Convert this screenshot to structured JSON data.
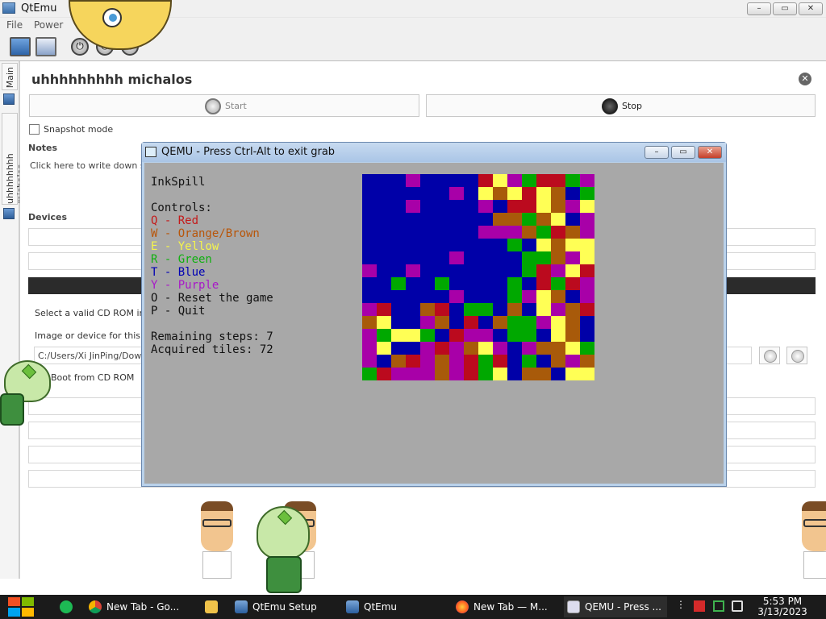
{
  "qtemu": {
    "title": "QtEmu",
    "menu": [
      "File",
      "Power"
    ],
    "window_buttons": [
      "–",
      "▭",
      "✕"
    ],
    "power_icons": [
      "⏻",
      "⏻",
      "⏻"
    ]
  },
  "side_tabs": [
    "Main",
    "uhhhhhhhh michalos"
  ],
  "machine": {
    "name": "uhhhhhhhhh michalos",
    "start_label": "Start",
    "stop_label": "Stop",
    "snapshot_label": "Snapshot mode",
    "notes_label": "Notes",
    "notes_placeholder": "Click here to write down some",
    "devices_label": "Devices",
    "cdrom_hint": "Select a valid CD ROM image",
    "image_label": "Image or device for this virt",
    "image_path": "C:/Users/Xi JinPing/Downlo",
    "boot_label": "Boot from CD ROM"
  },
  "qemu": {
    "title": "QEMU - Press Ctrl-Alt to exit grab",
    "buttons": [
      "–",
      "▭",
      "✕"
    ],
    "game_title": "InkSpill",
    "controls_heading": "Controls:",
    "controls": [
      {
        "text": "Q - Red",
        "color": "#c41a1a"
      },
      {
        "text": "W - Orange/Brown",
        "color": "#b8560a"
      },
      {
        "text": "E - Yellow",
        "color": "#f4f44c"
      },
      {
        "text": "R - Green",
        "color": "#10b010"
      },
      {
        "text": "T - Blue",
        "color": "#0000b4"
      },
      {
        "text": "Y - Purple",
        "color": "#a818c8"
      },
      {
        "text": "O - Reset the game",
        "color": "#111111"
      },
      {
        "text": "P - Quit",
        "color": "#111111"
      }
    ],
    "remaining": "Remaining steps: 7",
    "acquired": "Acquired tiles: 72",
    "palette": {
      "B": "#0000a8",
      "R": "#bb0a1e",
      "O": "#a85a0a",
      "Y": "#ffff55",
      "G": "#00a800",
      "P": "#a800a8"
    },
    "grid": [
      "BBBPBBBBRYPGRRGP",
      "BBBBBBPBYOYRYOBG",
      "BBBPBBBBPBRRYOPY",
      "BBBBBBBBBOOGOYBP",
      "BBBBBBBBPPPOGROP",
      "BBBBBBBBBBGBYOYY",
      "BBBBBBPBBBBGGOPY",
      "PBBPBBBBBBBGRPYR",
      "BBGBBGBBBBGBRGRP",
      "BBBBBBPBBBGPYOBP",
      "PRBBORBGGBOBYPOR",
      "OYBBPOBRBOGGPYOB",
      "PGYYGBRPPBGGBYOB",
      "PYBBPRPOYPBPOOYG",
      "PBORPOPRGRBGBOPO",
      "GRPPPOPRGYBOOBYY"
    ]
  },
  "taskbar": {
    "items": [
      {
        "label": "New Tab - Go...",
        "icon": "chrome-icon"
      },
      {
        "label": "",
        "icon": "folder-icon"
      },
      {
        "label": "QtEmu Setup",
        "icon": "qtemu-setup-icon"
      },
      {
        "label": "QtEmu",
        "icon": "qtemu-icon"
      },
      {
        "label": "New Tab — M...",
        "icon": "firefox-icon"
      },
      {
        "label": "QEMU - Press ...",
        "icon": "qemu-icon"
      }
    ],
    "time": "5:53 PM",
    "date": "3/13/2023"
  }
}
